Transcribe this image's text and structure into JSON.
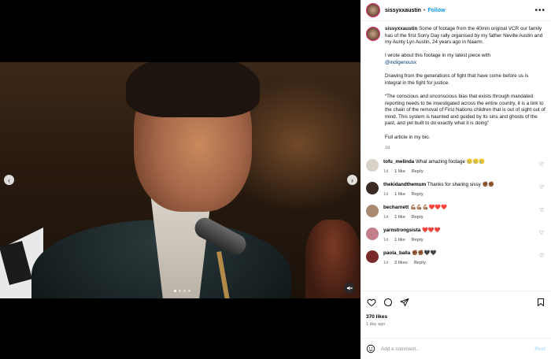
{
  "post": {
    "username": "sissyxxaustin",
    "separator": "•",
    "follow_label": "Follow",
    "more_label": "•••",
    "caption": {
      "username": "sissyxxaustin",
      "paragraph1": "Some of footage from the 40min original VCR our family has of the first Sorry Day rally organised by my father Neville Austin and my Aunty Lyn Austin, 24 years ago in Naarm.",
      "paragraph2_text": "I wrote about this footage in my latest piece with",
      "paragraph2_mention": "@indigenousx",
      "paragraph3": "Drawing from the generations of fight that have come before us is integral in the fight for justice.",
      "paragraph4": "“The conscious and unconscious bias that exists through mandated reporting needs to be investigated across the entire country, it is a link to the chain of the removal of First Nations children that is out of sight out of mind. This system is haunted and guided by its sins and ghosts of the past, and yet built to do exactly what it is doing”",
      "paragraph5": "Full article in my bio.",
      "time": "1d"
    },
    "comments": [
      {
        "username": "tofu_melinda",
        "text": "What amazing footage 🥲🥲🥲",
        "time": "1d",
        "likes": "1 like",
        "reply": "Reply",
        "avatar_color": "#d9d2c9"
      },
      {
        "username": "thekidandthemum",
        "text": "Thanks for sharing sissy ✊🏾✊🏾",
        "time": "1d",
        "likes": "1 like",
        "reply": "Reply",
        "avatar_color": "#3b2a24"
      },
      {
        "username": "becharnett",
        "text": "💪🏽💪🏽💪🏽❤️❤️❤️",
        "time": "1d",
        "likes": "1 like",
        "reply": "Reply",
        "avatar_color": "#a88a72"
      },
      {
        "username": "yarnstrongsista",
        "text": "❤️❤️❤️",
        "time": "1d",
        "likes": "1 like",
        "reply": "Reply",
        "avatar_color": "#c47e8a"
      },
      {
        "username": "paola_balla",
        "text": "✊🏾✊🏾🖤🖤",
        "time": "1d",
        "likes": "2 likes",
        "reply": "Reply",
        "avatar_color": "#7a2a2a"
      }
    ],
    "likes_total": "370 likes",
    "posted_ago": "1 day ago",
    "add_comment_placeholder": "Add a comment...",
    "post_label": "Post"
  },
  "media": {
    "slide_count": 4,
    "active_slide": 1,
    "prev_icon": "‹",
    "next_icon": "›"
  }
}
